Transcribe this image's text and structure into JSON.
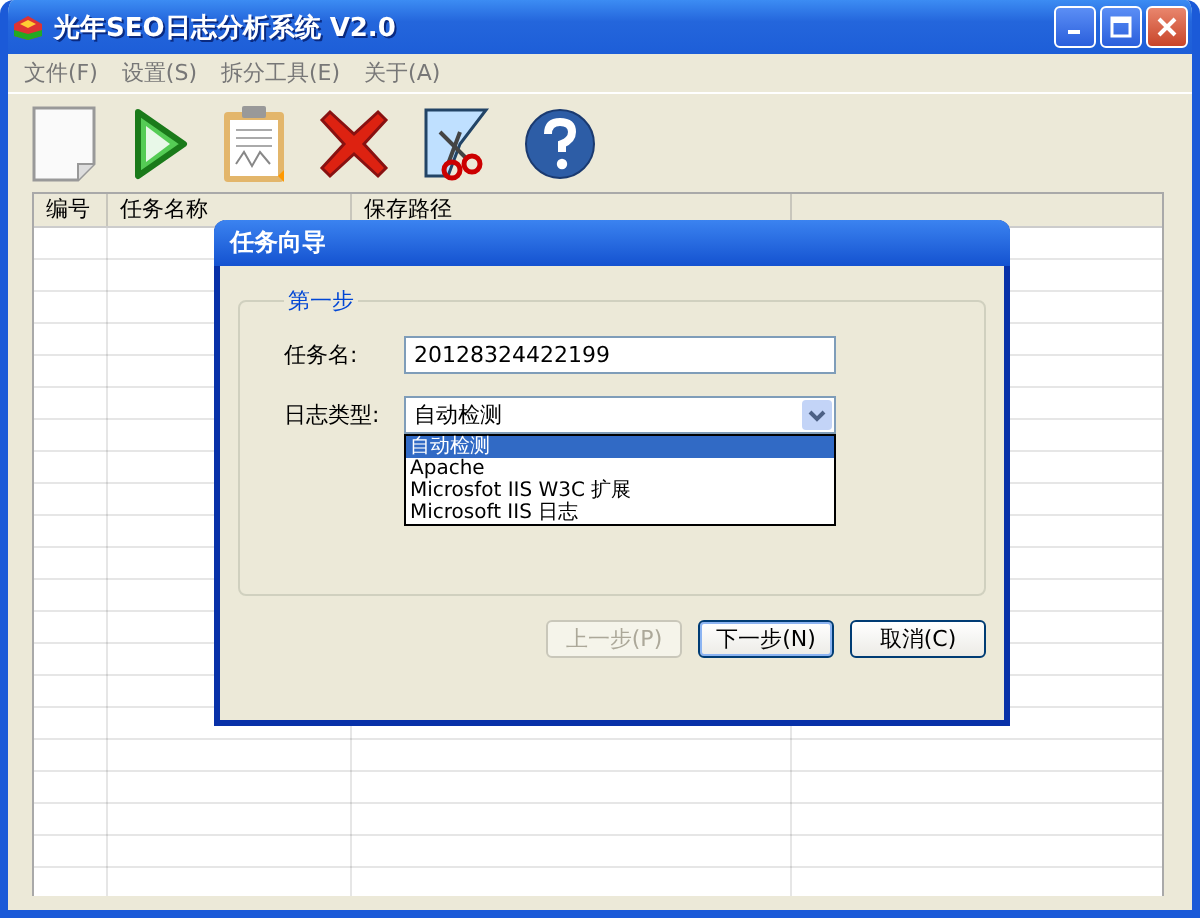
{
  "window": {
    "title": "光年SEO日志分析系统 V2.0"
  },
  "menu": [
    "文件(F)",
    "设置(S)",
    "拆分工具(E)",
    "关于(A)"
  ],
  "table": {
    "columns": [
      "编号",
      "任务名称",
      "保存路径"
    ]
  },
  "dialog": {
    "title": "任务向导",
    "group": "第一步",
    "fields": [
      {
        "kind": "text",
        "label": "任务名:",
        "value": "20128324422199"
      },
      {
        "kind": "combo",
        "label": "日志类型:",
        "value": "自动检测",
        "expanded": true,
        "options": [
          {
            "label": "自动检测",
            "selected": true
          },
          {
            "label": "Apache",
            "selected": false
          },
          {
            "label": "Microsfot IIS W3C 扩展",
            "selected": false
          },
          {
            "label": "Microsoft IIS 日志",
            "selected": false
          }
        ]
      }
    ],
    "buttons": [
      {
        "label": "上一步(P)",
        "disabled": true,
        "default": false
      },
      {
        "label": "下一步(N)",
        "disabled": false,
        "default": true
      },
      {
        "label": "取消(C)",
        "disabled": false,
        "default": false
      }
    ]
  }
}
